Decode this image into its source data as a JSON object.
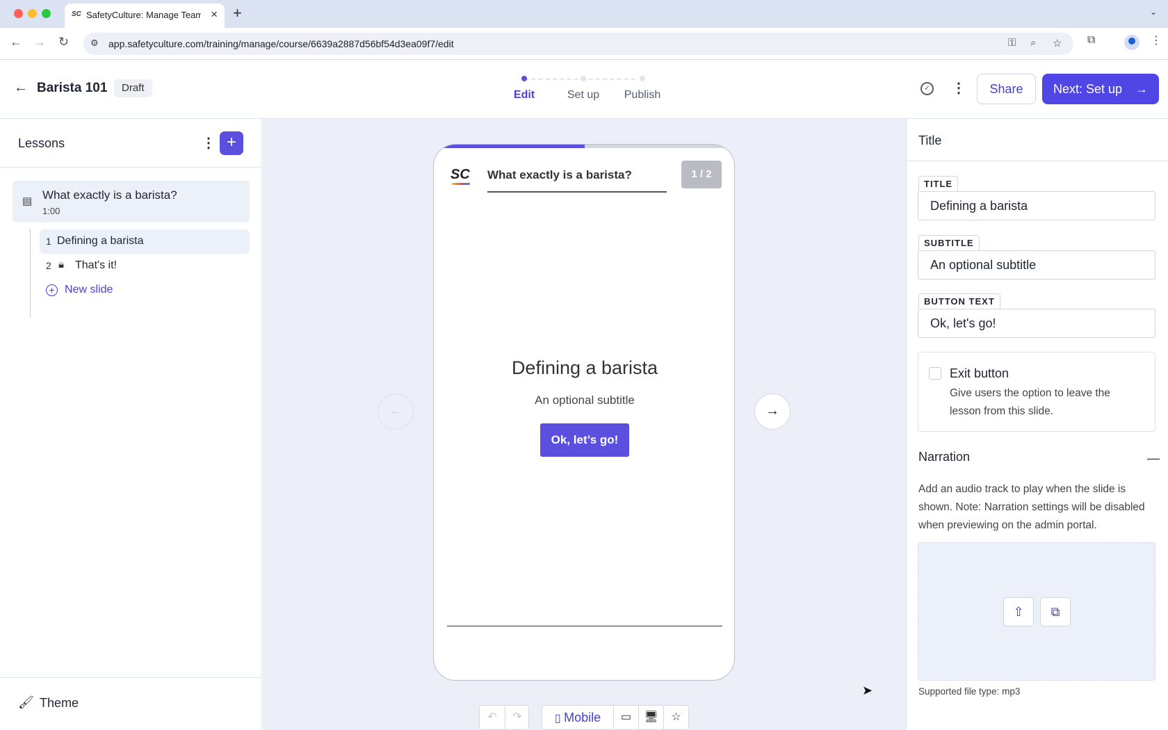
{
  "browser": {
    "tab_title": "SafetyCulture: Manage Teams",
    "tab_favicon": "SC",
    "url": "app.safetyculture.com/training/manage/course/6639a2887d56bf54d3ea09f7/edit"
  },
  "header": {
    "course_name": "Barista 101",
    "status": "Draft",
    "steps": [
      "Edit",
      "Set up",
      "Publish"
    ],
    "active_step": "Edit",
    "share_label": "Share",
    "next_label": "Next: Set up"
  },
  "sidebar": {
    "title": "Lessons",
    "lesson": {
      "title": "What exactly is a barista?",
      "duration": "1:00"
    },
    "slides": [
      {
        "num": "1",
        "label": "Defining a barista",
        "locked": false,
        "selected": true
      },
      {
        "num": "2",
        "label": "That's it!",
        "locked": true,
        "selected": false
      }
    ],
    "new_slide_label": "New slide",
    "theme_label": "Theme"
  },
  "preview": {
    "logo": "SC",
    "lesson_title": "What exactly is a barista?",
    "pager": "1 / 2",
    "progress": 0.5,
    "slide_title": "Defining a barista",
    "slide_subtitle": "An optional subtitle",
    "button_text": "Ok, let’s go!",
    "device_label": "Mobile"
  },
  "panel": {
    "section_title": "Title",
    "title_label": "TITLE",
    "title_value": "Defining a barista",
    "subtitle_label": "SUBTITLE",
    "subtitle_value": "An optional subtitle",
    "button_label": "BUTTON TEXT",
    "button_value": "Ok, let's go!",
    "exit_title": "Exit button",
    "exit_desc": "Give users the option to leave the lesson from this slide.",
    "exit_checked": false,
    "narration_title": "Narration",
    "narration_desc": "Add an audio track to play when the slide is shown. Note: Narration settings will be disabled when previewing on the admin portal.",
    "file_type": "Supported file type: mp3"
  },
  "colors": {
    "accent": "#4f46e5",
    "canvas": "#eceff8",
    "selected": "#ecf0f9"
  }
}
